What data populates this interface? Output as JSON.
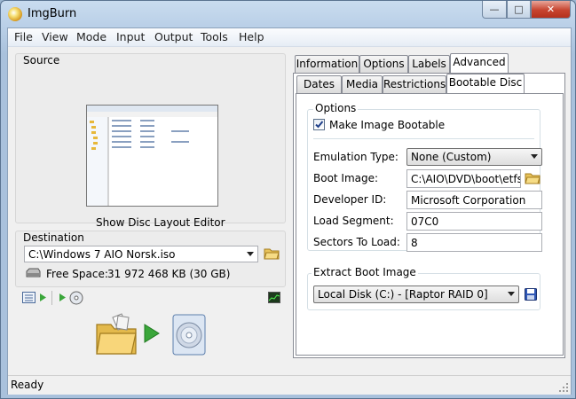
{
  "window": {
    "title": "ImgBurn"
  },
  "menu": [
    "File",
    "View",
    "Mode",
    "Input",
    "Output",
    "Tools",
    "Help"
  ],
  "source": {
    "group_label": "Source",
    "editor_label": "Show Disc Layout Editor"
  },
  "destination": {
    "group_label": "Destination",
    "path": "C:\\Windows 7 AIO Norsk.iso",
    "free_space_label": "Free Space:",
    "free_space_value": "31 972 468 KB  (30 GB)"
  },
  "tabs_top": [
    "Information",
    "Options",
    "Labels",
    "Advanced"
  ],
  "tabs_top_active": "Advanced",
  "tabs_sub": [
    "Dates",
    "Media",
    "Restrictions",
    "Bootable Disc"
  ],
  "tabs_sub_active": "Bootable Disc",
  "options": {
    "group_label": "Options",
    "make_bootable_label": "Make Image Bootable",
    "make_bootable_checked": true,
    "emulation_type_label": "Emulation Type:",
    "emulation_type_value": "None (Custom)",
    "boot_image_label": "Boot Image:",
    "boot_image_value": "C:\\AIO\\DVD\\boot\\etfsboot.com",
    "developer_id_label": "Developer ID:",
    "developer_id_value": "Microsoft Corporation",
    "load_segment_label": "Load Segment:",
    "load_segment_value": "07C0",
    "sectors_to_load_label": "Sectors To Load:",
    "sectors_to_load_value": "8"
  },
  "extract": {
    "group_label": "Extract Boot Image",
    "drive_value": "Local Disk (C:) - [Raptor RAID 0]"
  },
  "status": {
    "text": "Ready"
  },
  "colors": {
    "accent_green": "#3aa63a",
    "title_bar": "#b9cfe7",
    "close_red": "#c7442f"
  }
}
